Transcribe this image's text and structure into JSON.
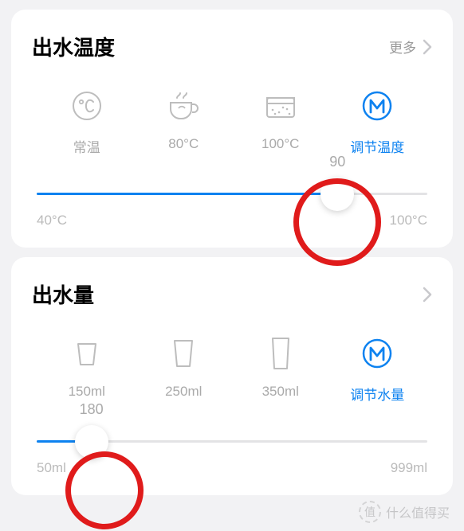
{
  "temp_card": {
    "title": "出水温度",
    "more_label": "更多",
    "options": [
      {
        "label": "常温"
      },
      {
        "label": "80°C"
      },
      {
        "label": "100°C"
      },
      {
        "label": "调节温度",
        "active": true
      }
    ],
    "slider": {
      "value": 90,
      "min": 40,
      "max": 100,
      "min_label": "40°C",
      "max_label": "100°C",
      "fill_pct": 77
    }
  },
  "volume_card": {
    "title": "出水量",
    "options": [
      {
        "label": "150ml"
      },
      {
        "label": "250ml"
      },
      {
        "label": "350ml"
      },
      {
        "label": "调节水量",
        "active": true
      }
    ],
    "slider": {
      "value": 180,
      "min": 50,
      "max": 999,
      "min_label": "50ml",
      "max_label": "999ml",
      "fill_pct": 14
    }
  },
  "watermark": {
    "text": "什么值得买",
    "badge": "值"
  },
  "colors": {
    "accent": "#0d82f0",
    "annot": "#e01b1b"
  }
}
